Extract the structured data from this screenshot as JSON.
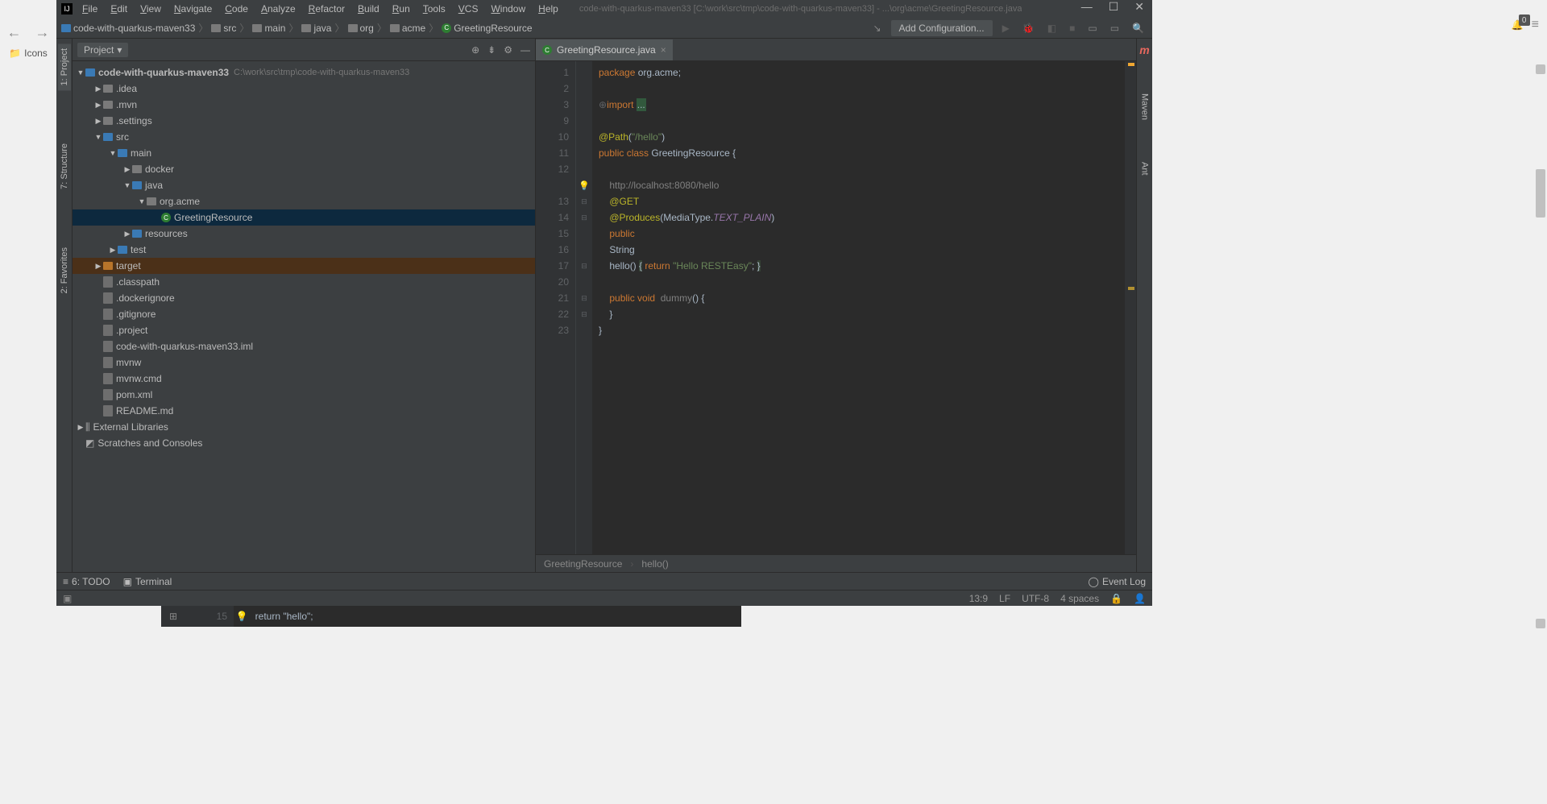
{
  "browser_nav": {
    "back": "←",
    "forward": "→"
  },
  "sidebar_left": {
    "icons_label": "Icons"
  },
  "titlebar": {
    "menus": [
      "File",
      "Edit",
      "View",
      "Navigate",
      "Code",
      "Analyze",
      "Refactor",
      "Build",
      "Run",
      "Tools",
      "VCS",
      "Window",
      "Help"
    ],
    "title": "code-with-quarkus-maven33 [C:\\work\\src\\tmp\\code-with-quarkus-maven33] - ...\\org\\acme\\GreetingResource.java",
    "win": {
      "min": "—",
      "max": "☐",
      "close": "✕"
    }
  },
  "toolbar": {
    "crumbs": [
      "code-with-quarkus-maven33",
      "src",
      "main",
      "java",
      "org",
      "acme",
      "GreetingResource"
    ],
    "add_config": "Add Configuration...",
    "icons": {
      "build": "🔨",
      "run": "▶",
      "debug": "🐞",
      "stop": "■",
      "search": "🔍"
    }
  },
  "project_pane": {
    "header": "Project",
    "root": {
      "name": "code-with-quarkus-maven33",
      "path": "C:\\work\\src\\tmp\\code-with-quarkus-maven33"
    },
    "tree": [
      {
        "indent": 1,
        "arrow": "▶",
        "icon": "folder",
        "name": ".idea"
      },
      {
        "indent": 1,
        "arrow": "▶",
        "icon": "folder",
        "name": ".mvn"
      },
      {
        "indent": 1,
        "arrow": "▶",
        "icon": "folder",
        "name": ".settings"
      },
      {
        "indent": 1,
        "arrow": "▼",
        "icon": "folder-blue",
        "name": "src"
      },
      {
        "indent": 2,
        "arrow": "▼",
        "icon": "folder-blue",
        "name": "main"
      },
      {
        "indent": 3,
        "arrow": "▶",
        "icon": "folder",
        "name": "docker"
      },
      {
        "indent": 3,
        "arrow": "▼",
        "icon": "folder-blue",
        "name": "java"
      },
      {
        "indent": 4,
        "arrow": "▼",
        "icon": "folder",
        "name": "org.acme"
      },
      {
        "indent": 5,
        "arrow": "",
        "icon": "class",
        "name": "GreetingResource",
        "selected": "selected"
      },
      {
        "indent": 3,
        "arrow": "▶",
        "icon": "folder-blue",
        "name": "resources"
      },
      {
        "indent": 2,
        "arrow": "▶",
        "icon": "folder-blue",
        "name": "test"
      },
      {
        "indent": 1,
        "arrow": "▶",
        "icon": "folder-orange",
        "name": "target",
        "selected": "selected-alt"
      },
      {
        "indent": 1,
        "arrow": "",
        "icon": "file",
        "name": ".classpath"
      },
      {
        "indent": 1,
        "arrow": "",
        "icon": "file",
        "name": ".dockerignore"
      },
      {
        "indent": 1,
        "arrow": "",
        "icon": "file",
        "name": ".gitignore"
      },
      {
        "indent": 1,
        "arrow": "",
        "icon": "file",
        "name": ".project"
      },
      {
        "indent": 1,
        "arrow": "",
        "icon": "file",
        "name": "code-with-quarkus-maven33.iml"
      },
      {
        "indent": 1,
        "arrow": "",
        "icon": "file",
        "name": "mvnw"
      },
      {
        "indent": 1,
        "arrow": "",
        "icon": "file",
        "name": "mvnw.cmd"
      },
      {
        "indent": 1,
        "arrow": "",
        "icon": "file",
        "name": "pom.xml"
      },
      {
        "indent": 1,
        "arrow": "",
        "icon": "file",
        "name": "README.md"
      }
    ],
    "extra": [
      {
        "indent": 0,
        "arrow": "▶",
        "icon": "lib",
        "name": "External Libraries"
      },
      {
        "indent": 0,
        "arrow": "",
        "icon": "scratch",
        "name": "Scratches and Consoles"
      }
    ]
  },
  "left_tabs": [
    "1: Project",
    "7: Structure",
    "2: Favorites"
  ],
  "right_tabs": [
    "Maven",
    "Ant"
  ],
  "editor": {
    "tab": "GreetingResource.java",
    "line_numbers": [
      "1",
      "2",
      "3",
      "9",
      "10",
      "11",
      "12",
      "",
      "13",
      "14",
      "15",
      "16",
      "17",
      "20",
      "21",
      "22",
      "23"
    ],
    "url_hint": "http://localhost:8080/hello",
    "crumb": {
      "class": "GreetingResource",
      "method": "hello()"
    }
  },
  "bottom": {
    "todo": "6: TODO",
    "terminal": "Terminal",
    "event_log": "Event Log"
  },
  "status": {
    "pos": "13:9",
    "sep": "LF",
    "enc": "UTF-8",
    "indent": "4 spaces"
  },
  "bg_editor": {
    "line": "15",
    "kw": "return",
    "str": "\"hello\"",
    "tail": ";"
  },
  "notif": {
    "count": "0"
  }
}
